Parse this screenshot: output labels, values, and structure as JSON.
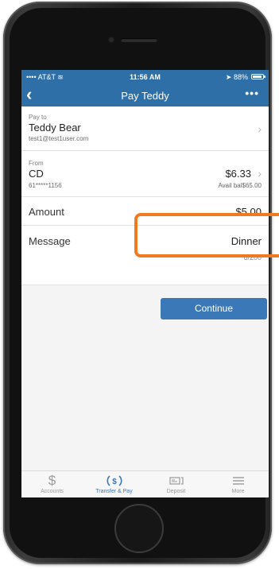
{
  "status_bar": {
    "carrier": "AT&T",
    "time": "11:56 AM",
    "battery": "88%"
  },
  "nav": {
    "back_icon": "chevron-left-icon",
    "title": "Pay Teddy",
    "more_label": "•••"
  },
  "pay_to": {
    "label": "Pay to",
    "name": "Teddy Bear",
    "email": "test1@test1user.com"
  },
  "from": {
    "label": "From",
    "account": "CD",
    "account_number": "61*****1156",
    "balance": "$6.33",
    "available": "Avail bal$65.00"
  },
  "amount": {
    "label": "Amount",
    "value": "$5.00"
  },
  "message": {
    "label": "Message",
    "value": "Dinner",
    "counter": "6/200"
  },
  "continue_label": "Continue",
  "tabs": [
    {
      "label": "Accounts",
      "icon": "dollar-icon",
      "active": false
    },
    {
      "label": "Transfer & Pay",
      "icon": "transfer-dollar-icon",
      "active": true
    },
    {
      "label": "Deposit",
      "icon": "check-deposit-icon",
      "active": false
    },
    {
      "label": "More",
      "icon": "menu-icon",
      "active": false
    }
  ],
  "colors": {
    "brand_blue": "#2f6fa8",
    "button_blue": "#3a78b8",
    "highlight_orange": "#f07a1d"
  }
}
